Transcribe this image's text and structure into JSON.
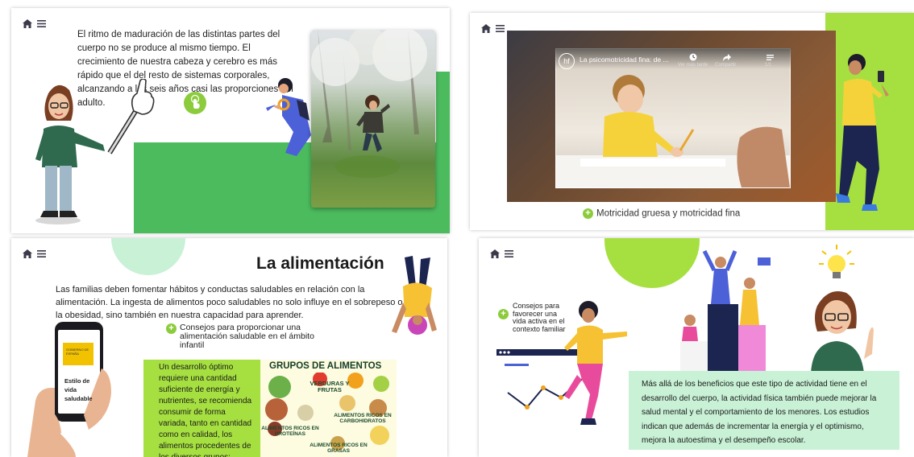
{
  "panel1": {
    "text": "El ritmo de maduración de las distintas partes del cuerpo no se produce al mismo tiempo. El crecimiento de nuestra cabeza y cerebro es más rápido que el del resto de sistemas corporales, alcanzando a los seis años casi las proporciones del adulto."
  },
  "panel2": {
    "video_title": "La psicomotricidad fina: de ...",
    "video_logo": "hf",
    "watch_later": "Ver más tarde",
    "share": "Compartir",
    "counter": "1/1",
    "caption": "Motricidad gruesa y motricidad fina"
  },
  "panel3": {
    "title": "La alimentación",
    "intro": "Las familias deben fomentar hábitos y conductas saludables en relación con la alimentación. La ingesta de alimentos poco saludables no solo influye en el sobrepeso o la obesidad, sino también en nuestra capacidad para aprender.",
    "phone_badge": "GOBIERNO DE ESPAÑA",
    "phone_text": "Estilo de vida saludable",
    "tips_link": "Consejos para proporcionar una alimentación saludable en el ámbito infantil",
    "body": "Un desarrollo óptimo requiere una cantidad suficiente de energía y nutrientes, se recomienda consumir de forma variada, tanto en cantidad como en calidad, los alimentos procedentes de los diversos grupos:",
    "groups_title": "GRUPOS DE ALIMENTOS",
    "groups": [
      "VERDURAS Y FRUTAS",
      "ALIMENTOS RICOS EN CARBOHIDRATOS",
      "ALIMENTOS RICOS EN PROTEÍNAS",
      "ALIMENTOS RICOS EN GRASAS"
    ]
  },
  "panel4": {
    "tips_link": "Consejos para favorecer una vida activa en el contexto familiar",
    "body": "Más allá de los beneficios que este tipo de actividad tiene en el desarrollo del cuerpo, la actividad física también puede mejorar la salud mental y el comportamiento de los menores. Los estudios indican que además de incrementar la energía y el optimismo, mejora la autoestima y el desempeño escolar."
  },
  "colors": {
    "green": "#4cbb5e",
    "lime": "#a6e040",
    "mint": "#c8f1d6",
    "accent": "#8ccc3c"
  }
}
